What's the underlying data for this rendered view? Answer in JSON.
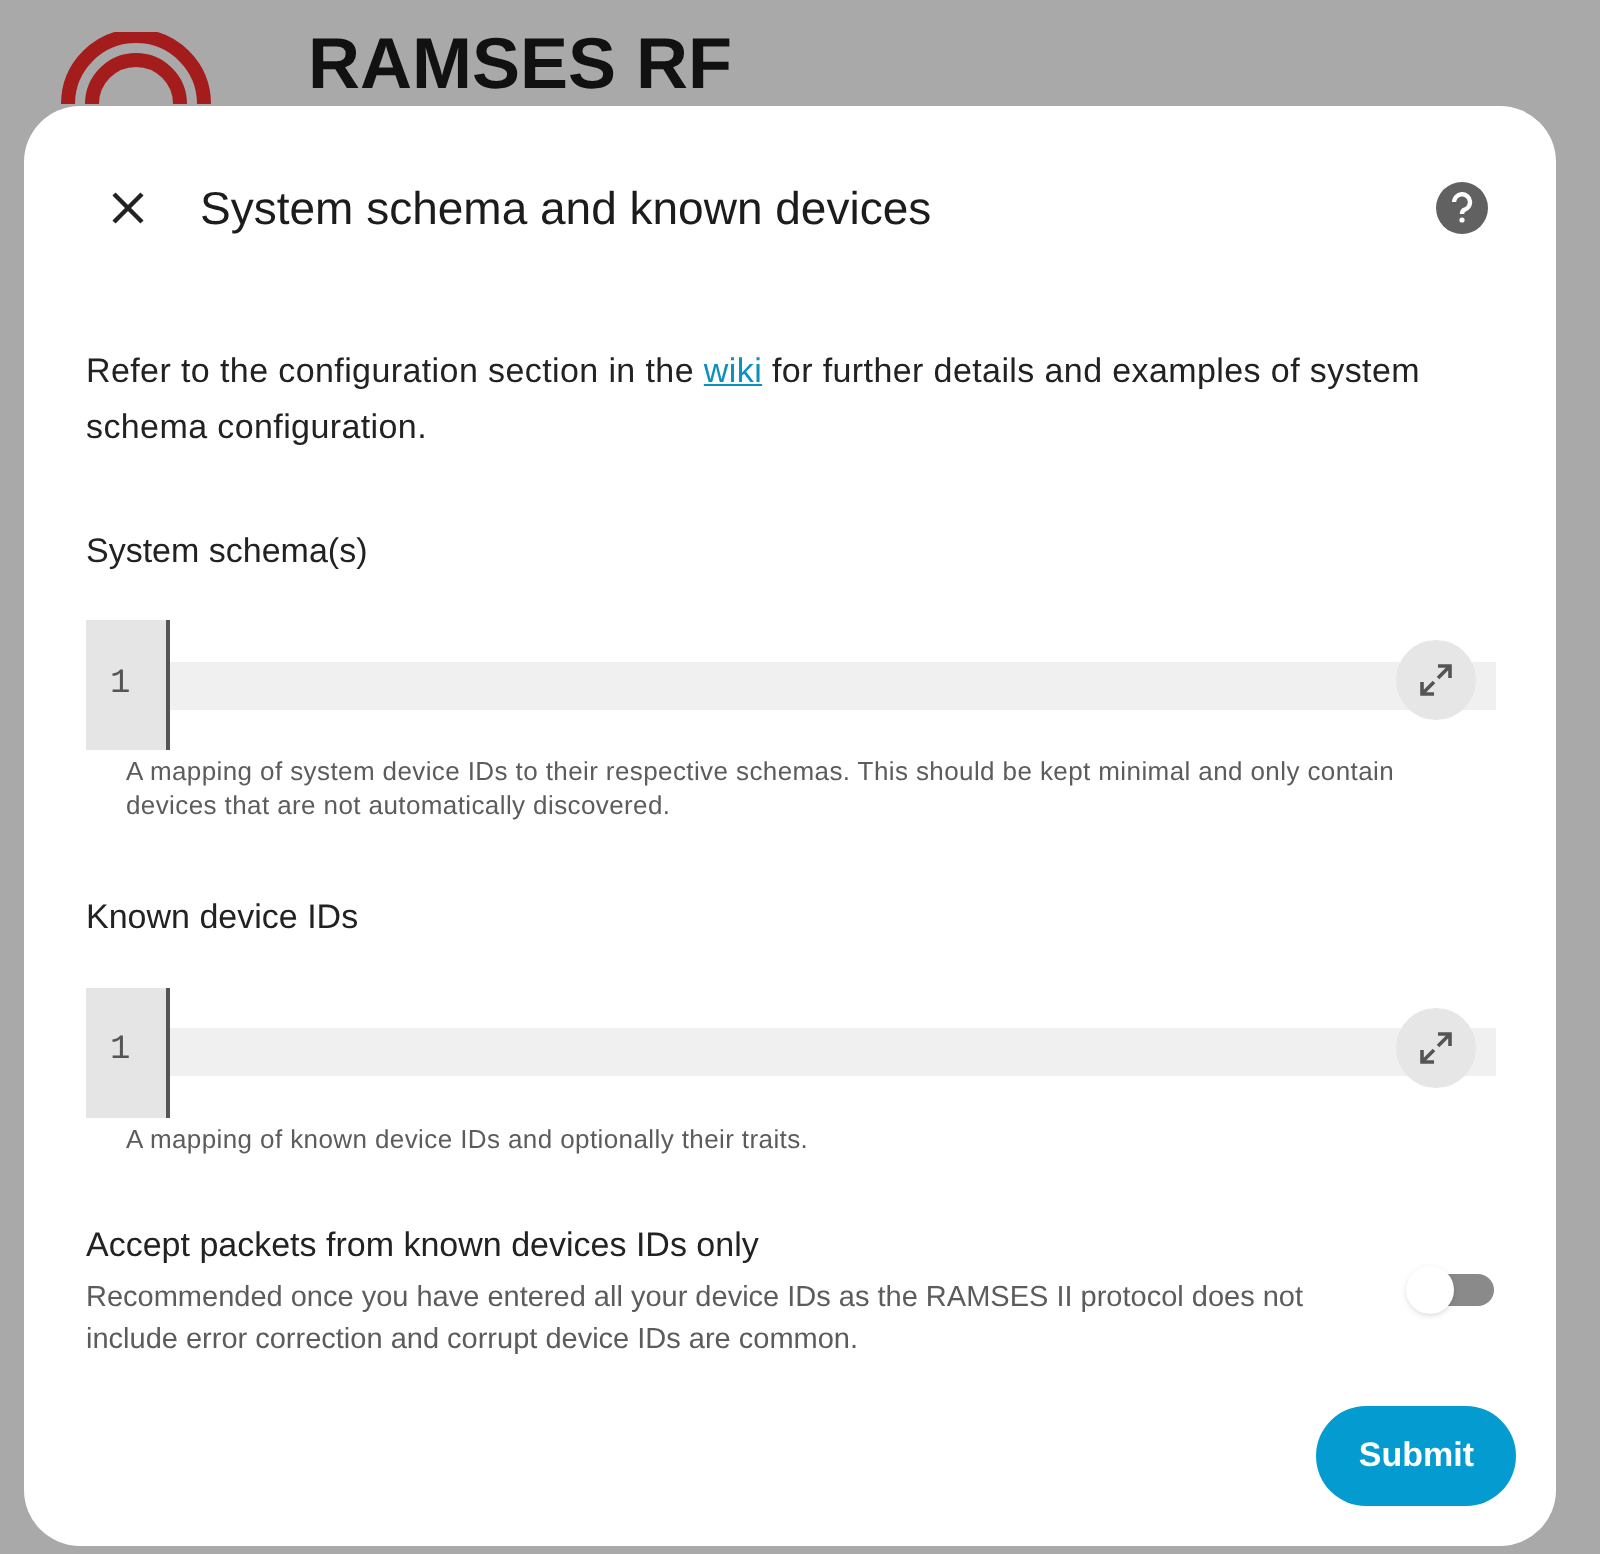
{
  "background": {
    "title": "RAMSES RF"
  },
  "dialog": {
    "title": "System schema and known devices",
    "intro": {
      "before": "Refer to the configuration section in the ",
      "link": "wiki",
      "after": " for further details and examples of system schema configuration."
    },
    "editors": [
      {
        "label": "System schema(s)",
        "line_number": "1",
        "helper": "A mapping of system device IDs to their respective schemas. This should be kept minimal and only contain devices that are not automatically discovered."
      },
      {
        "label": "Known device IDs",
        "line_number": "1",
        "helper": "A mapping of known device IDs and optionally their traits."
      }
    ],
    "toggle": {
      "label": "Accept packets from known devices IDs only",
      "description": "Recommended once you have entered all your device IDs as the RAMSES II protocol does not include error correction and corrupt device IDs are common.",
      "on": false
    },
    "submit": "Submit"
  }
}
